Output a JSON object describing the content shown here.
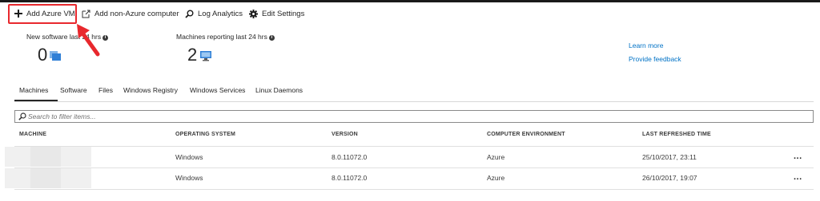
{
  "toolbar": {
    "add_azure_vm": "Add Azure VM",
    "add_non_azure": "Add non-Azure computer",
    "log_analytics": "Log Analytics",
    "edit_settings": "Edit Settings"
  },
  "stats": {
    "new_software_label": "New software last 24 hrs",
    "new_software_value": "0",
    "machines_reporting_label": "Machines reporting last 24 hrs",
    "machines_reporting_value": "2"
  },
  "links": {
    "learn_more": "Learn more",
    "provide_feedback": "Provide feedback"
  },
  "tabs": [
    "Machines",
    "Software",
    "Files",
    "Windows Registry",
    "Windows Services",
    "Linux Daemons"
  ],
  "search": {
    "placeholder": "Search to filter items..."
  },
  "table": {
    "columns": [
      "MACHINE",
      "OPERATING SYSTEM",
      "VERSION",
      "COMPUTER ENVIRONMENT",
      "LAST REFRESHED TIME"
    ],
    "rows": [
      {
        "machine": "",
        "os": "Windows",
        "version": "8.0.11072.0",
        "environment": "Azure",
        "last_refreshed": "25/10/2017, 23:11",
        "more": "..."
      },
      {
        "machine": "",
        "os": "Windows",
        "version": "8.0.11072.0",
        "environment": "Azure",
        "last_refreshed": "26/10/2017, 19:07",
        "more": "..."
      }
    ]
  },
  "colors": {
    "highlight": "#e8282d",
    "link": "#0072c6",
    "icon_blue": "#2f7fd6"
  }
}
